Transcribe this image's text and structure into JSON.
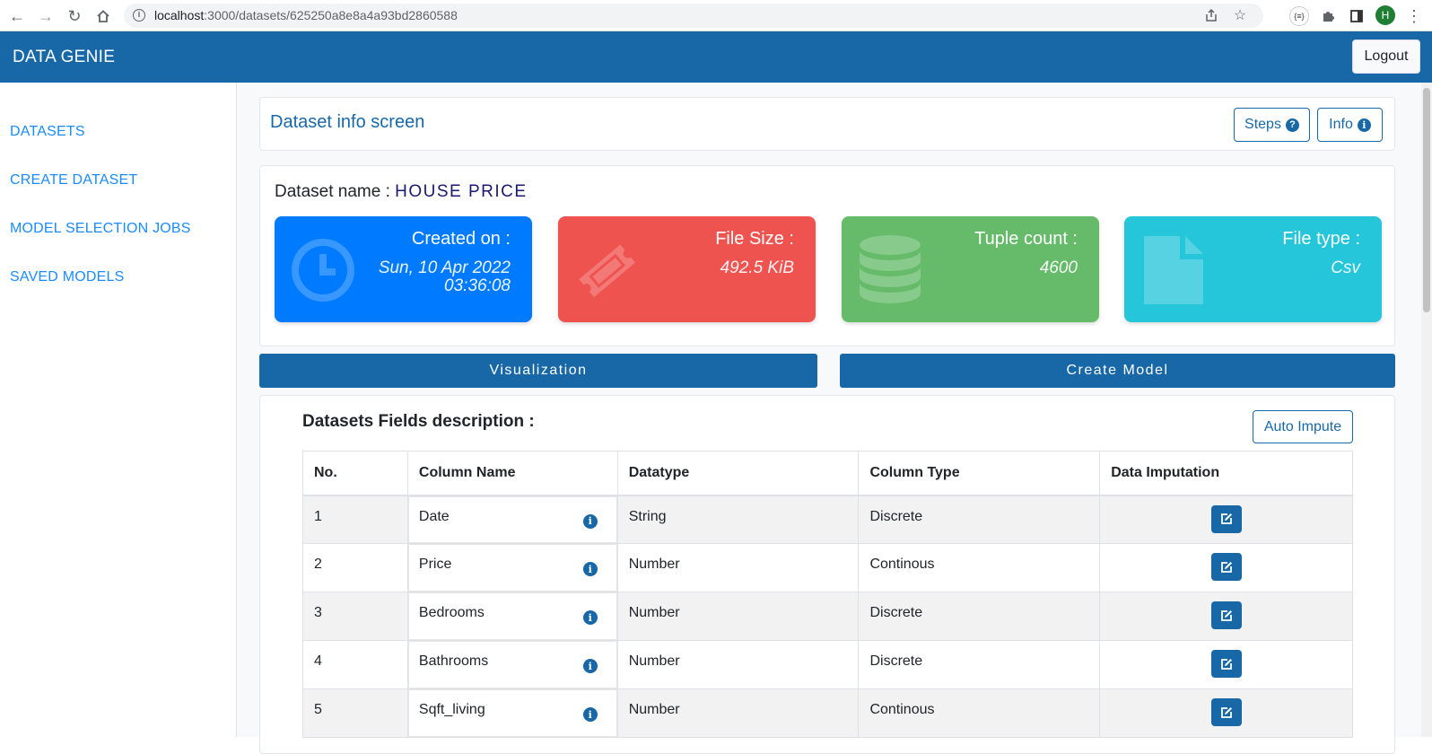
{
  "browser": {
    "url_host": "localhost",
    "url_path": ":3000/datasets/625250a8e8a4a93bd2860588",
    "profile_initial": "H"
  },
  "header": {
    "brand": "DATA GENIE",
    "logout_label": "Logout"
  },
  "sidebar": {
    "items": [
      {
        "label": "DATASETS"
      },
      {
        "label": "CREATE DATASET"
      },
      {
        "label": "MODEL SELECTION JOBS"
      },
      {
        "label": "SAVED MODELS"
      }
    ]
  },
  "info_bar": {
    "title": "Dataset info screen",
    "steps_label": "Steps",
    "info_label": "Info"
  },
  "dataset": {
    "name_label": "Dataset name :",
    "name_value": "HOUSE PRICE",
    "stats": {
      "created": {
        "label": "Created on :",
        "value_line1": "Sun, 10 Apr 2022",
        "value_line2": "03:36:08",
        "color": "#007bff"
      },
      "size": {
        "label": "File Size :",
        "value": "492.5 KiB",
        "color": "#ef5350"
      },
      "tuples": {
        "label": "Tuple count :",
        "value": "4600",
        "color": "#66bb6a"
      },
      "type": {
        "label": "File type :",
        "value": "Csv",
        "color": "#26c6da"
      }
    }
  },
  "actions": {
    "visualization_label": "Visualization",
    "create_model_label": "Create Model"
  },
  "fields": {
    "title": "Datasets Fields description :",
    "auto_impute_label": "Auto Impute",
    "columns": {
      "no": "No.",
      "name": "Column Name",
      "datatype": "Datatype",
      "coltype": "Column Type",
      "imputation": "Data Imputation"
    },
    "rows": [
      {
        "no": "1",
        "name": "Date",
        "datatype": "String",
        "coltype": "Discrete"
      },
      {
        "no": "2",
        "name": "Price",
        "datatype": "Number",
        "coltype": "Continous"
      },
      {
        "no": "3",
        "name": "Bedrooms",
        "datatype": "Number",
        "coltype": "Discrete"
      },
      {
        "no": "4",
        "name": "Bathrooms",
        "datatype": "Number",
        "coltype": "Discrete"
      },
      {
        "no": "5",
        "name": "Sqft_living",
        "datatype": "Number",
        "coltype": "Continous"
      }
    ]
  },
  "colors": {
    "primary": "#1868a8",
    "link": "#1a8cff"
  }
}
